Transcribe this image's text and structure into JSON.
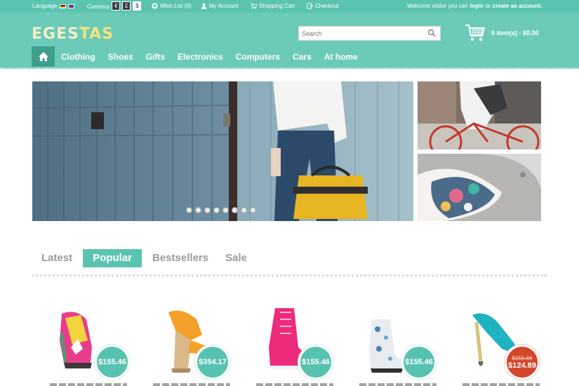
{
  "topbar": {
    "language_label": "Language",
    "currency_label": "Currency",
    "currencies": [
      "€",
      "£",
      "$"
    ],
    "wishlist": "Wish List (0)",
    "my_account": "My Account",
    "shopping_cart": "Shopping Cart",
    "checkout": "Checkout",
    "welcome_prefix": "Welcome visitor you can",
    "login": "login",
    "or": "or",
    "create_account": "create an account."
  },
  "header": {
    "logo_main": "EGES",
    "logo_accent": "TAS",
    "search_placeholder": "Search",
    "cart_summary": "0 item(s) - $0.00"
  },
  "nav": {
    "items": [
      "Clothing",
      "Shoes",
      "Gifts",
      "Electronics",
      "Computers",
      "Cars",
      "At home"
    ]
  },
  "slider": {
    "dot_count": 8,
    "active_dot": 2
  },
  "tabs": {
    "items": [
      "Latest",
      "Popular",
      "Bestsellers",
      "Sale"
    ],
    "active": "Popular"
  },
  "products": [
    {
      "price": "$155.46"
    },
    {
      "price": "$354.17"
    },
    {
      "price": "$155.46"
    },
    {
      "price": "$155.46"
    },
    {
      "old_price": "$155.46",
      "price": "$124.89"
    }
  ],
  "colors": {
    "brand": "#5bc4b0",
    "header": "#6bcbb8",
    "sale": "#d4462a"
  }
}
